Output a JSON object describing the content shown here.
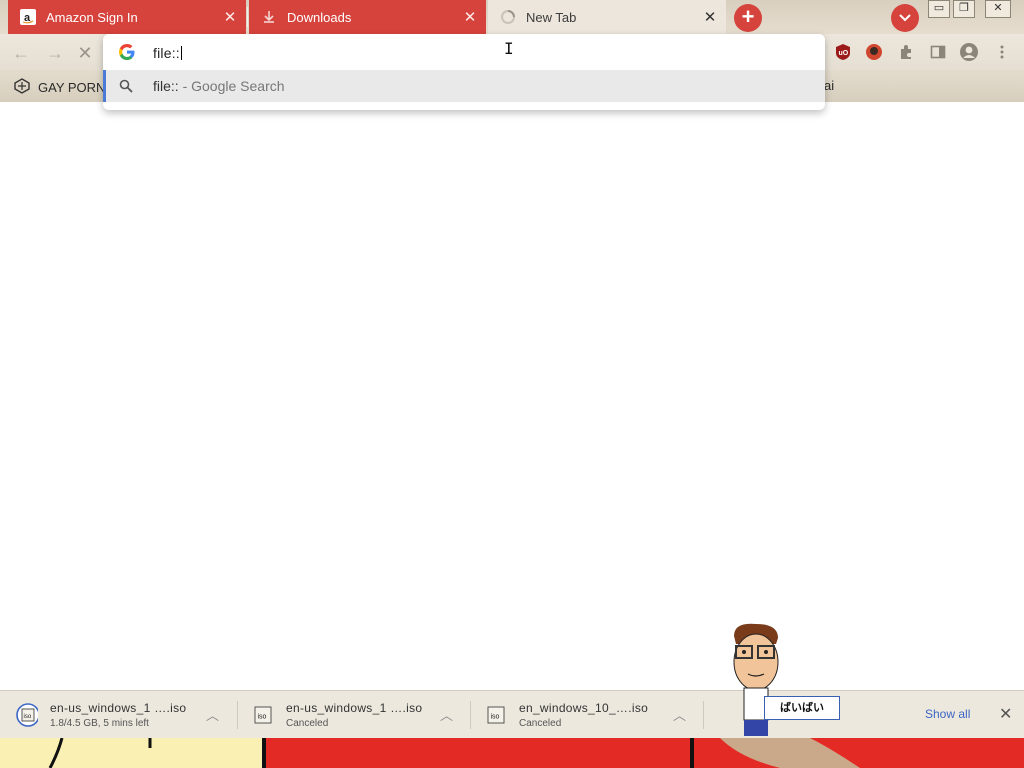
{
  "tabs": [
    {
      "title": "Amazon Sign In",
      "favicon": "amazon-icon",
      "style": "red"
    },
    {
      "title": "Downloads",
      "favicon": "download-icon",
      "style": "red"
    },
    {
      "title": "New Tab",
      "favicon": "loading-icon",
      "style": "active"
    }
  ],
  "window_controls": {
    "minimize": "▭",
    "maximize": "❐",
    "close": "✕"
  },
  "new_tab_symbol": "+",
  "omnibox": {
    "input_value": "file::",
    "suggestion_query": "file::",
    "suggestion_suffix": " - Google Search"
  },
  "bookmarks": [
    {
      "label": "GAY PORN",
      "icon": "bookmark-site-icon"
    },
    {
      "label": "ai",
      "icon": ""
    }
  ],
  "downloads": [
    {
      "name": "en-us_windows_1 ….iso",
      "status": "1.8/4.5 GB, 5 mins left",
      "icon": "iso-file-icon"
    },
    {
      "name": "en-us_windows_1 ….iso",
      "status": "Canceled",
      "icon": "iso-file-icon"
    },
    {
      "name": "en_windows_10_….iso",
      "status": "Canceled",
      "icon": "iso-file-icon"
    }
  ],
  "show_all_label": "Show all",
  "speech_bubble": "ばいばい",
  "colors": {
    "tab_red": "#d6433c",
    "link_blue": "#3b66c4",
    "wallpaper_red": "#e42a25"
  }
}
